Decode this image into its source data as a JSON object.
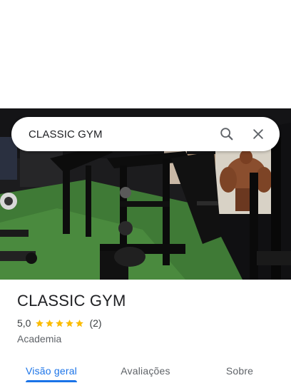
{
  "search": {
    "query": "CLASSIC GYM",
    "search_icon": "search-icon",
    "close_icon": "close-icon"
  },
  "hero": {
    "photo": "gym-interior-photo"
  },
  "place": {
    "title": "CLASSIC GYM",
    "rating": "5,0",
    "stars": 5,
    "review_count": "(2)",
    "category": "Academia"
  },
  "tabs": [
    {
      "label": "Visão geral",
      "active": true
    },
    {
      "label": "Avaliações",
      "active": false
    },
    {
      "label": "Sobre",
      "active": false
    }
  ],
  "colors": {
    "accent": "#1a73e8",
    "star": "#fbbc04"
  }
}
